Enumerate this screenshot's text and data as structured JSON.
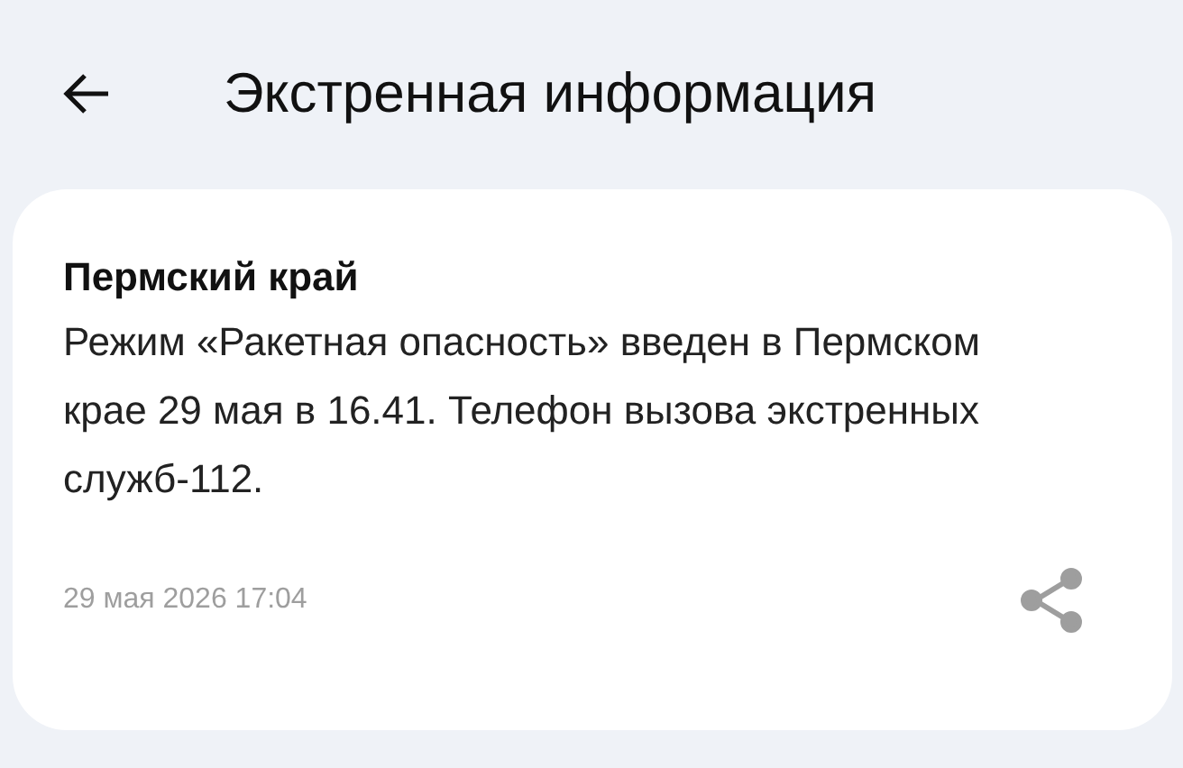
{
  "header": {
    "title": "Экстренная информация"
  },
  "message": {
    "region": "Пермский край",
    "text": "Режим «Ракетная опасность» введен в Пермском крае 29 мая в 16.41. Телефон вызова экстренных служб-112.",
    "date": "29 мая 2026 17:04"
  }
}
